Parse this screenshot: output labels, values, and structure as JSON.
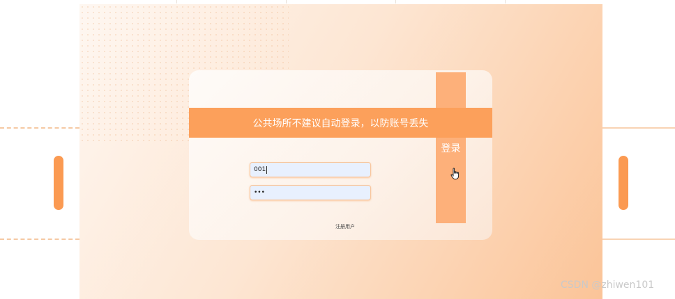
{
  "banner": {
    "text": "公共场所不建议自动登录，以防账号丢失"
  },
  "login": {
    "label": "登录"
  },
  "username": {
    "value": "001"
  },
  "password": {
    "value": "•••"
  },
  "register": {
    "label": "注册用户"
  },
  "watermark": {
    "text": "CSDN @zhiwen101"
  },
  "colors": {
    "accent": "#fca05b",
    "button": "#fdb07a",
    "input_bg": "#e8f0fe"
  }
}
